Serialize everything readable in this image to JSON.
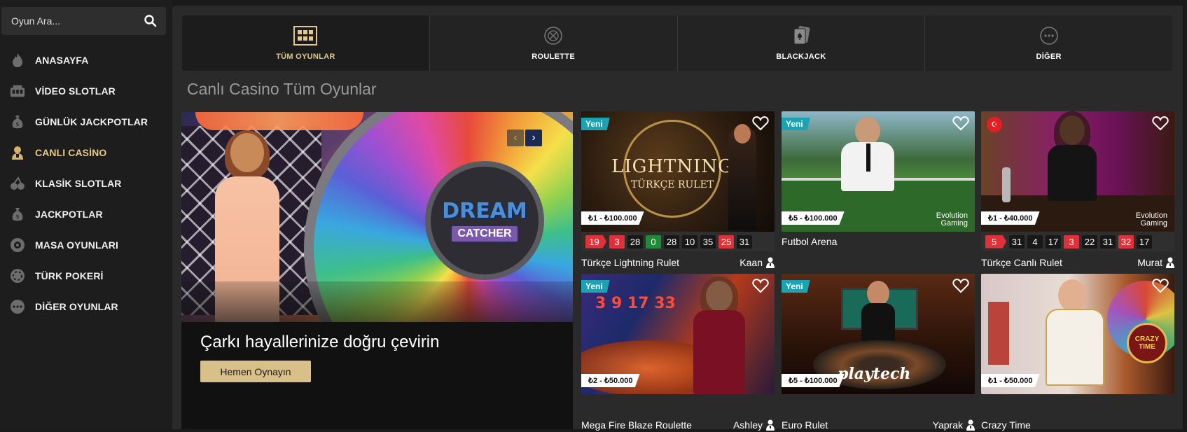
{
  "search": {
    "placeholder": "Oyun Ara..."
  },
  "sidebar": {
    "items": [
      {
        "label": "ANASAYFA",
        "icon": "flame-icon"
      },
      {
        "label": "VİDEO SLOTLAR",
        "icon": "slot-machine-icon"
      },
      {
        "label": "GÜNLÜK JACKPOTLAR",
        "icon": "money-bag-icon"
      },
      {
        "label": "CANLI CASİNO",
        "icon": "dealer-icon",
        "active": true
      },
      {
        "label": "KLASİK SLOTLAR",
        "icon": "cherries-icon"
      },
      {
        "label": "JACKPOTLAR",
        "icon": "money-bag-icon"
      },
      {
        "label": "MASA OYUNLARI",
        "icon": "roulette-icon"
      },
      {
        "label": "TÜRK POKERİ",
        "icon": "poker-chip-icon"
      },
      {
        "label": "DİĞER OYUNLAR",
        "icon": "more-icon"
      }
    ]
  },
  "tabs": [
    {
      "label": "TÜM OYUNLAR",
      "icon": "grid-icon",
      "active": true
    },
    {
      "label": "ROULETTE",
      "icon": "roulette-wheel-icon"
    },
    {
      "label": "BLACKJACK",
      "icon": "cards-icon"
    },
    {
      "label": "DİĞER",
      "icon": "more-icon"
    }
  ],
  "page_title": "Canlı Casino Tüm Oyunlar",
  "hero": {
    "logo_top": "DREAM",
    "logo_bottom": "CATCHER",
    "title": "Çarkı hayallerinize doğru çevirin",
    "button": "Hemen Oynayın"
  },
  "games": [
    {
      "name": "Türkçe Lightning Rulet",
      "dealer": "Kaan",
      "badge": "Yeni",
      "limit": "₺1 - ₺100.000",
      "logo_text": "LIGHTNING",
      "logo_sub": "TÜRKÇE RULET",
      "results": [
        "19",
        "3",
        "28",
        "0",
        "28",
        "10",
        "35",
        "25",
        "31"
      ]
    },
    {
      "name": "Futbol Arena",
      "badge": "Yeni",
      "limit": "₺5 - ₺100.000",
      "provider": "Evolution Gaming"
    },
    {
      "name": "Türkçe Canlı Rulet",
      "dealer": "Murat",
      "limit": "₺1 - ₺40.000",
      "provider": "Evolution Gaming",
      "flag": "☪",
      "results": [
        "5",
        "31",
        "4",
        "17",
        "3",
        "22",
        "31",
        "32",
        "17"
      ]
    },
    {
      "name": "Mega Fire Blaze Roulette",
      "dealer": "Ashley",
      "badge": "Yeni",
      "limit": "₺2 - ₺50.000",
      "scene_numbers": "3  9  17  33"
    },
    {
      "name": "Euro Rulet",
      "dealer": "Yaprak",
      "badge": "Yeni",
      "limit": "₺5 - ₺100.000",
      "provider": "playtech"
    },
    {
      "name": "Crazy Time",
      "limit": "₺1 - ₺50.000",
      "logo_text": "CRAZY TIME"
    }
  ],
  "colors": {
    "accent": "#e3c88c",
    "badge": "#1aa3b3",
    "red": "#e0313a",
    "green": "#1f8a3a"
  }
}
